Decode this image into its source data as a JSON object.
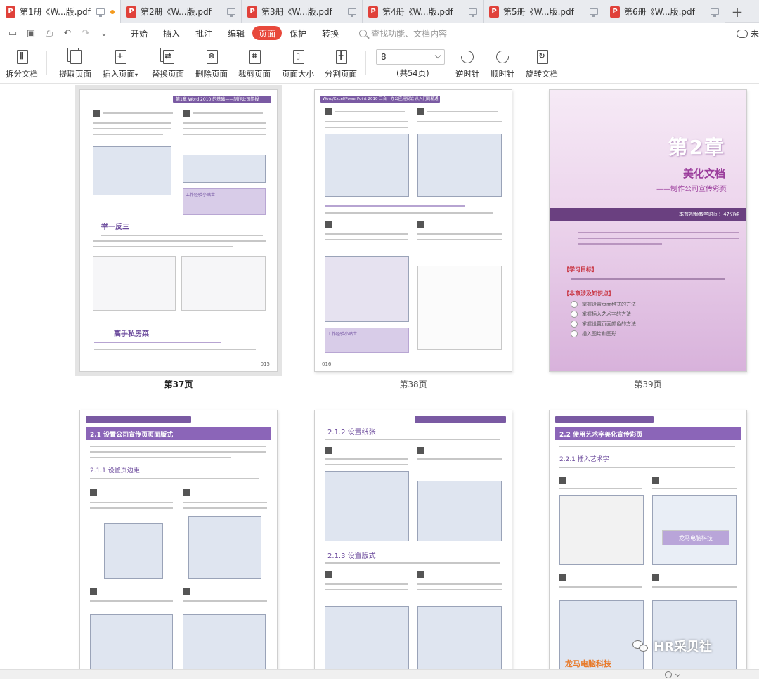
{
  "tabs": [
    {
      "label": "第1册《W...版.pdf",
      "active": true
    },
    {
      "label": "第2册《W...版.pdf",
      "active": false
    },
    {
      "label": "第3册《W...版.pdf",
      "active": false
    },
    {
      "label": "第4册《W...版.pdf",
      "active": false
    },
    {
      "label": "第5册《W...版.pdf",
      "active": false
    },
    {
      "label": "第6册《W...版.pdf",
      "active": false
    }
  ],
  "tab_add": "+",
  "menu": {
    "items": [
      "开始",
      "插入",
      "批注",
      "编辑",
      "页面",
      "保护",
      "转换"
    ],
    "active": "页面",
    "search_placeholder": "查找功能、文档内容",
    "cloud_label": "未"
  },
  "ribbon": {
    "split": "拆分文档",
    "extract": "提取页面",
    "insert": "插入页面",
    "replace": "替换页面",
    "delete": "删除页面",
    "crop": "裁剪页面",
    "size": "页面大小",
    "divide": "分割页面",
    "page_input_value": "8",
    "page_total": "(共54页)",
    "rotate_ccw": "逆时针",
    "rotate_cw": "顺时针",
    "rotate_doc": "旋转文档"
  },
  "pages": [
    {
      "caption": "第37页",
      "selected": true,
      "header": "第1章 Word 2010 的基础——制作公司简报",
      "section_title": "举一反三",
      "private_title": "高手私房菜",
      "tip_title": "工作经验小贴士",
      "page_no": "015"
    },
    {
      "caption": "第38页",
      "selected": false,
      "header": "Word/Excel/PowerPoint 2010 三合一办公应用实战 从入门到精通",
      "tip_title": "工作经验小贴士",
      "page_no": "016"
    },
    {
      "caption": "第39页",
      "selected": false,
      "chapter": "第2章",
      "title": "美化文档",
      "subtitle": "——制作公司宣传彩页",
      "time_note": "本节视频教学时间：47分钟",
      "learn_heading": "【学习目标】",
      "points_heading": "【本章涉及知识点】",
      "points": [
        "掌握设置页面格式的方法",
        "掌握插入艺术字的方法",
        "掌握设置页面颜色的方法",
        "插入图片和图形"
      ]
    },
    {
      "caption": "",
      "selected": false,
      "band": "2.1 设置公司宣传页页面版式",
      "sub1": "2.1.1 设置页边距"
    },
    {
      "caption": "",
      "selected": false,
      "sub1": "2.1.2 设置纸张",
      "sub2": "2.1.3 设置版式"
    },
    {
      "caption": "",
      "selected": false,
      "band": "2.2 使用艺术字美化宣传彩页",
      "sub1": "2.2.1 插入艺术字",
      "art_text": "龙马电脑科技",
      "art_text_small": "龙马电脑科技"
    }
  ],
  "watermark": "HR采贝社",
  "colors": {
    "accent": "#e8483b",
    "pdf_icon": "#e0413a",
    "unsaved_dot": "#f39a1d",
    "book_purple": "#7a5aa3"
  }
}
